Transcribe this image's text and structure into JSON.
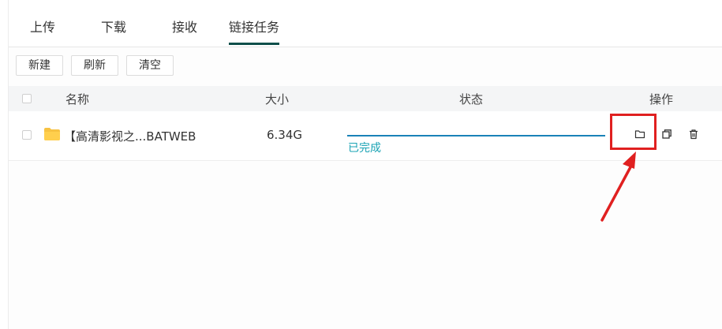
{
  "tabs": [
    {
      "label": "上传",
      "active": false
    },
    {
      "label": "下载",
      "active": false
    },
    {
      "label": "接收",
      "active": false
    },
    {
      "label": "链接任务",
      "active": true
    }
  ],
  "toolbar": {
    "new_label": "新建",
    "refresh_label": "刷新",
    "clear_label": "清空"
  },
  "table": {
    "headers": {
      "name": "名称",
      "size": "大小",
      "status": "状态",
      "actions": "操作"
    },
    "rows": [
      {
        "name": "【高清影视之...BATWEB",
        "size": "6.34G",
        "status": "已完成",
        "progress": 1.0
      }
    ]
  },
  "icons": {
    "folder": "folder-icon",
    "open_folder": "folder-outline-icon",
    "copy": "copy-icon",
    "delete": "trash-icon"
  },
  "colors": {
    "accent": "#0e4f4a",
    "progress": "#1a82b8",
    "status": "#1aa3b4",
    "folder": "#f7c242",
    "annotation": "#e02020"
  }
}
